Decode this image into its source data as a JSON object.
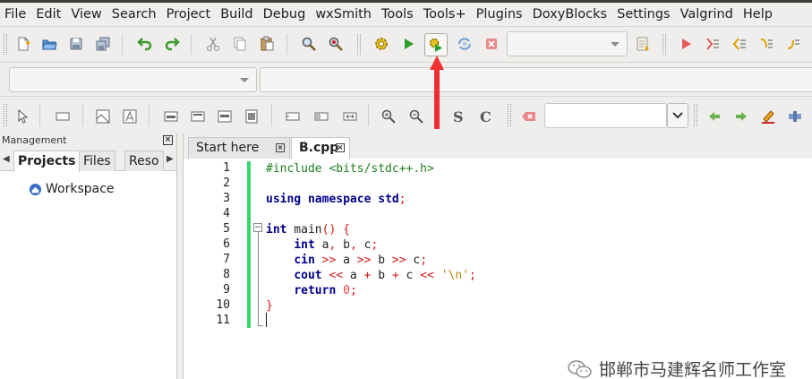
{
  "menubar": {
    "items": [
      "File",
      "Edit",
      "View",
      "Search",
      "Project",
      "Build",
      "Debug",
      "wxSmith",
      "Tools",
      "Tools+",
      "Plugins",
      "DoxyBlocks",
      "Settings",
      "Valgrind",
      "Help"
    ]
  },
  "toolbar": {
    "target_combo_value": "",
    "scope_combo_value": "",
    "function_combo_value": "",
    "search_value": ""
  },
  "management": {
    "title": "Management",
    "tabs": [
      "Projects",
      "Files",
      "Reso"
    ],
    "active_tab": "Projects",
    "tree": [
      {
        "label": "Workspace",
        "icon": "workspace-icon"
      }
    ]
  },
  "editor": {
    "tabs": [
      {
        "label": "Start here",
        "active": false
      },
      {
        "label": "B.cpp",
        "active": true
      }
    ],
    "line_numbers": [
      "1",
      "2",
      "3",
      "4",
      "5",
      "6",
      "7",
      "8",
      "9",
      "10",
      "11"
    ],
    "code_lines": [
      [
        {
          "t": "#include <bits/stdc++.h>",
          "c": "pp"
        }
      ],
      [],
      [
        {
          "t": "using",
          "c": "kw"
        },
        {
          "t": " ",
          "c": "id"
        },
        {
          "t": "namespace",
          "c": "kw"
        },
        {
          "t": " ",
          "c": "id"
        },
        {
          "t": "std",
          "c": "kw"
        },
        {
          "t": ";",
          "c": "op"
        }
      ],
      [],
      [
        {
          "t": "int",
          "c": "kw"
        },
        {
          "t": " main",
          "c": "id"
        },
        {
          "t": "()",
          "c": "op"
        },
        {
          "t": " ",
          "c": "id"
        },
        {
          "t": "{",
          "c": "op"
        }
      ],
      [
        {
          "t": "    ",
          "c": "id"
        },
        {
          "t": "int",
          "c": "kw"
        },
        {
          "t": " a",
          "c": "id"
        },
        {
          "t": ",",
          "c": "op"
        },
        {
          "t": " b",
          "c": "id"
        },
        {
          "t": ",",
          "c": "op"
        },
        {
          "t": " c",
          "c": "id"
        },
        {
          "t": ";",
          "c": "op"
        }
      ],
      [
        {
          "t": "    ",
          "c": "id"
        },
        {
          "t": "cin",
          "c": "kw"
        },
        {
          "t": " ",
          "c": "id"
        },
        {
          "t": ">>",
          "c": "op"
        },
        {
          "t": " a ",
          "c": "id"
        },
        {
          "t": ">>",
          "c": "op"
        },
        {
          "t": " b ",
          "c": "id"
        },
        {
          "t": ">>",
          "c": "op"
        },
        {
          "t": " c",
          "c": "id"
        },
        {
          "t": ";",
          "c": "op"
        }
      ],
      [
        {
          "t": "    ",
          "c": "id"
        },
        {
          "t": "cout",
          "c": "kw"
        },
        {
          "t": " ",
          "c": "id"
        },
        {
          "t": "<<",
          "c": "op"
        },
        {
          "t": " a ",
          "c": "id"
        },
        {
          "t": "+",
          "c": "op"
        },
        {
          "t": " b ",
          "c": "id"
        },
        {
          "t": "+",
          "c": "op"
        },
        {
          "t": " c ",
          "c": "id"
        },
        {
          "t": "<<",
          "c": "op"
        },
        {
          "t": " ",
          "c": "id"
        },
        {
          "t": "'\\n'",
          "c": "str"
        },
        {
          "t": ";",
          "c": "op"
        }
      ],
      [
        {
          "t": "    ",
          "c": "id"
        },
        {
          "t": "return",
          "c": "kw"
        },
        {
          "t": " ",
          "c": "id"
        },
        {
          "t": "0",
          "c": "num"
        },
        {
          "t": ";",
          "c": "op"
        }
      ],
      [
        {
          "t": "}",
          "c": "op"
        }
      ],
      []
    ]
  },
  "watermark": {
    "text": "邯郸市马建辉名师工作室"
  },
  "colors": {
    "keyword": "#00008b",
    "preprocessor": "#208020",
    "operator": "#d61a1a",
    "number": "#f04040",
    "string": "#b8860b",
    "change_bar": "#32d96a",
    "annotation_arrow": "#f03030"
  }
}
